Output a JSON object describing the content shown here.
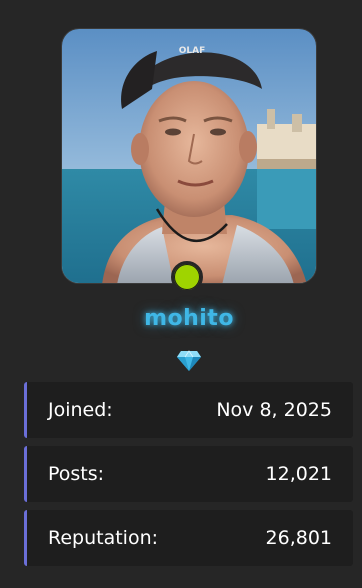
{
  "profile": {
    "username": "mohito",
    "username_color": "#3fb7e6",
    "online_status_color": "#9fd400",
    "rank_icon": "diamond-icon",
    "avatar_image": "profile-photo"
  },
  "stats": {
    "joined": {
      "label": "Joined:",
      "value": "Nov 8, 2025"
    },
    "posts": {
      "label": "Posts:",
      "value": "12,021"
    },
    "reputation": {
      "label": "Reputation:",
      "value": "26,801"
    }
  },
  "theme": {
    "background": "#262626",
    "stat_background": "#1e1e1e",
    "stat_accent": "#6b6fd8"
  }
}
